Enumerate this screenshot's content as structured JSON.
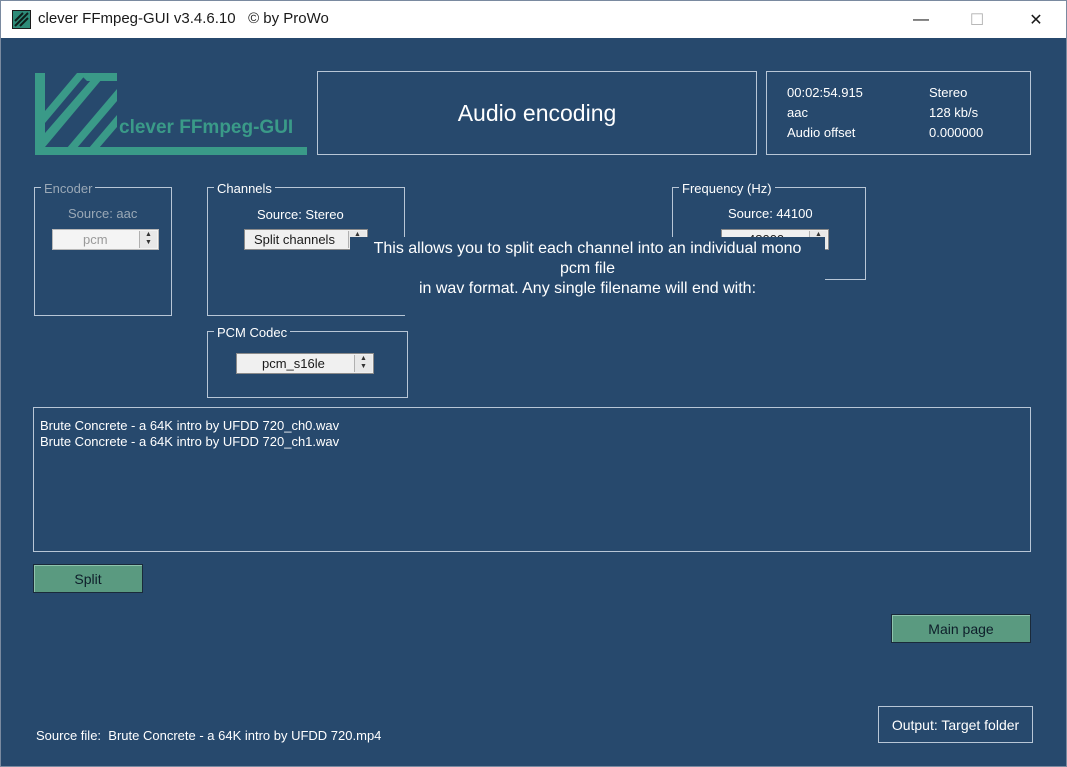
{
  "window": {
    "title": "clever FFmpeg-GUI v3.4.6.10   © by ProWo",
    "minimize_glyph": "—",
    "maximize_glyph": "☐",
    "close_glyph": "✕",
    "icon": "ffmpeg-app-icon"
  },
  "logo": {
    "text": "clever FFmpeg-GUI",
    "icon": "ffmpeg-logo-icon"
  },
  "header": {
    "title": "Audio encoding"
  },
  "info": {
    "duration": "00:02:54.915",
    "channels": "Stereo",
    "codec": "aac",
    "bitrate": "128 kb/s",
    "audio_offset_label": "Audio offset",
    "audio_offset_value": "0.000000"
  },
  "encoder": {
    "label": "Encoder",
    "source": "Source: aac",
    "value": "pcm"
  },
  "channels": {
    "label": "Channels",
    "source": "Source: Stereo",
    "value": "Split channels"
  },
  "frequency": {
    "label": "Frequency (Hz)",
    "source": "Source: 44100",
    "value": "48000"
  },
  "pcm_codec": {
    "label": "PCM Codec",
    "value": "pcm_s16le"
  },
  "tooltip": {
    "line1": "This allows you to split each channel into an individual mono",
    "line2": "pcm file",
    "line3": "in wav format. Any single filename will end with:"
  },
  "output_files": [
    "Brute Concrete - a 64K intro by UFDD 720_ch0.wav",
    "Brute Concrete - a 64K intro by UFDD 720_ch1.wav"
  ],
  "buttons": {
    "split": "Split",
    "main_page": "Main page",
    "output_target": "Output: Target folder"
  },
  "footer": {
    "label": "Source file:",
    "value": "Brute Concrete - a 64K intro by UFDD 720.mp4"
  },
  "colors": {
    "background": "#27496d",
    "accent": "#5a9a80",
    "logo": "#3a9a88"
  }
}
